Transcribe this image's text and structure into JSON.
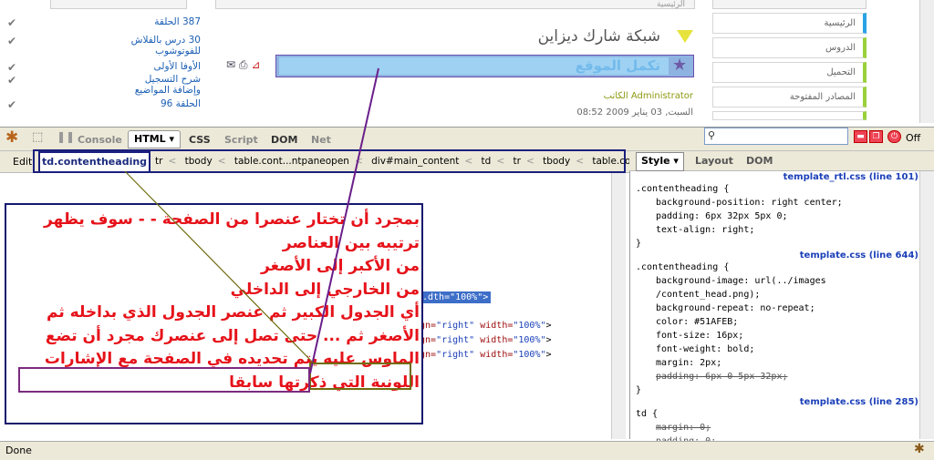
{
  "web": {
    "top_left_stub": "",
    "top_center_stub": "الرئيسية",
    "right_posts": [
      {
        "label": "387 الحلقة"
      },
      {
        "label": "30 درس بالفلاش"
      },
      {
        "label": "للفوتوشوب"
      },
      {
        "label": "الأوفا الأولى"
      },
      {
        "label": "شرح التسجيل"
      },
      {
        "label": "وإضافة المواضيع"
      },
      {
        "label": "الحلقة 96"
      }
    ],
    "page_title": "شبكة شارك ديزاين",
    "heading": "تكمل الموقع",
    "author": "الكاتب Administrator",
    "date": "السبت, 03 يناير 2009 08:52",
    "nav": [
      {
        "label": "الرئيسية",
        "active": true
      },
      {
        "label": "الدروس",
        "active": false
      },
      {
        "label": "التحميل",
        "active": false
      },
      {
        "label": "المصادر المفتوحة",
        "active": false
      },
      {
        "label": "",
        "active": false
      }
    ]
  },
  "firebug": {
    "tabs": [
      "Console",
      "HTML ▾",
      "CSS",
      "Script",
      "DOM",
      "Net"
    ],
    "selected_tab": "HTML ▾",
    "off_label": "Off",
    "edit_label": "Edit",
    "selected_crumb": "td.contentheading",
    "crumbs": [
      "tr",
      "tbody",
      "table.cont...ntpaneopen",
      "div#main_content",
      "td",
      "tr",
      "tbody",
      "table.content"
    ],
    "html_lines": [
      {
        "pre": ".dth=\"100%\">",
        "highlight": true
      },
      {
        "attr1": "gn=",
        "val1": "\"right\"",
        "attr2": " width=",
        "val2": "\"100%\"",
        "end": ">"
      },
      {
        "attr1": "gn=",
        "val1": "\"right\"",
        "attr2": " width=",
        "val2": "\"100%\"",
        "end": ">"
      },
      {
        "attr1": "gn=",
        "val1": "\"right\"",
        "attr2": " width=",
        "val2": "\"100%\"",
        "end": ">"
      }
    ],
    "side_tabs": [
      "Style ▾",
      "Layout",
      "DOM"
    ],
    "css_rules": [
      {
        "source": "template_rtl.css (line 101)",
        "selector": ".contentheading {",
        "props": [
          {
            "text": "background-position: right center;",
            "strike": false
          },
          {
            "text": "padding: 6px 32px 5px 0;",
            "strike": false
          },
          {
            "text": "text-align: right;",
            "strike": false
          }
        ]
      },
      {
        "source": "template.css (line 644)",
        "selector": ".contentheading {",
        "props": [
          {
            "text": "background-image: url(../images",
            "strike": false
          },
          {
            "text": "/content_head.png);",
            "strike": false
          },
          {
            "text": "background-repeat: no-repeat;",
            "strike": false
          },
          {
            "text": "color: #51AFEB;",
            "strike": false
          },
          {
            "text": "font-size: 16px;",
            "strike": false
          },
          {
            "text": "font-weight: bold;",
            "strike": false
          },
          {
            "text": "margin: 2px;",
            "strike": false
          },
          {
            "text": "padding: 6px 0 5px 32px;",
            "strike": true
          }
        ]
      },
      {
        "source": "template.css (line 285)",
        "selector": "td {",
        "props": [
          {
            "text": "margin: 0;",
            "strike": true
          },
          {
            "text": "padding: 0;",
            "strike": true
          }
        ]
      }
    ],
    "status": "Done"
  },
  "annotation": {
    "lines": [
      "بمجرد أن تختار عنصرا من الصفحة   - - سوف يظهر",
      "ترتيبه بين العناصر",
      "من الأكبر إلى الأصغر",
      "من الخارجي إلى الداخلي",
      "أي الجدول الكبير ثم عنصر الجدول     الذي بداخله ثم",
      "الأصغر ثم ...     حتى     تصل إلى عنصرك مجرد أن تضع",
      "الماوس عليه يتم تحديده في الصفحة     مع الإشارات",
      "اللونية التي ذكرتها سابقا"
    ],
    "colors": {
      "text": "#e6121a",
      "box": "#13186d",
      "olive": "#6f6d10",
      "purple": "#7b2a7f"
    }
  }
}
